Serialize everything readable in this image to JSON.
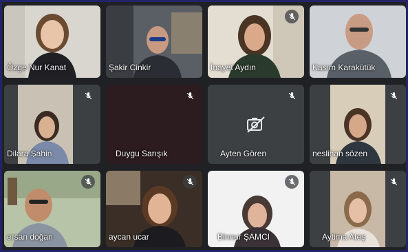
{
  "meeting": {
    "participants": [
      {
        "name": "Özge Nur Kanat",
        "muted": false,
        "video_on": true
      },
      {
        "name": "Şakir Cinkir",
        "muted": false,
        "video_on": true
      },
      {
        "name": "İnayet Aydın",
        "muted": true,
        "video_on": true
      },
      {
        "name": "Kasım Karakütük",
        "muted": false,
        "video_on": true
      },
      {
        "name": "Dilara Şahin",
        "muted": true,
        "video_on": true
      },
      {
        "name": "Duygu Sarışık",
        "muted": true,
        "video_on": false
      },
      {
        "name": "Ayten Gören",
        "muted": true,
        "video_on": false
      },
      {
        "name": "neslihan sözen",
        "muted": true,
        "video_on": true
      },
      {
        "name": "ersan doğan",
        "muted": true,
        "video_on": true
      },
      {
        "name": "aycan ucar",
        "muted": true,
        "video_on": true
      },
      {
        "name": "Binnur ŞAMCI",
        "muted": true,
        "video_on": true
      },
      {
        "name": "Aytima Ateş",
        "muted": true,
        "video_on": true
      }
    ]
  },
  "icons": {
    "mic_off": "mic-off-icon",
    "camera_off": "camera-off-icon"
  },
  "colors": {
    "background": "#202124",
    "tile_dark": "#2c1b1f",
    "tile_gray": "#3c4043",
    "frame_border": "#23236a"
  }
}
